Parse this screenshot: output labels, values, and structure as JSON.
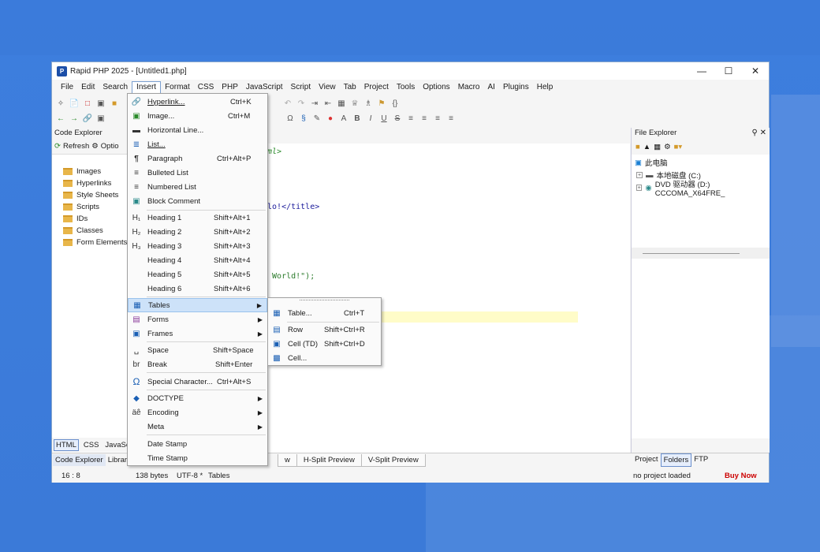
{
  "window": {
    "title": "Rapid PHP 2025 - [Untitled1.php]"
  },
  "menubar": [
    "File",
    "Edit",
    "Search",
    "Insert",
    "Format",
    "CSS",
    "PHP",
    "JavaScript",
    "Script",
    "View",
    "Tab",
    "Project",
    "Tools",
    "Options",
    "Macro",
    "AI",
    "Plugins",
    "Help"
  ],
  "code_explorer": {
    "title": "Code Explorer",
    "refresh": "Refresh",
    "options": "Optio",
    "items": [
      "Images",
      "Hyperlinks",
      "Style Sheets",
      "Scripts",
      "IDs",
      "Classes",
      "Form Elements"
    ],
    "bottom_tabs": [
      "HTML",
      "CSS",
      "JavaScri"
    ]
  },
  "editor": {
    "lines": [
      "tml>",
      "",
      "",
      "",
      "llo!</title>",
      "",
      "",
      "",
      "",
      ", World!\");",
      "",
      "",
      ""
    ]
  },
  "file_explorer": {
    "title": "File Explorer",
    "root": "此电脑",
    "drives": [
      "本地磁盘 (C:)",
      "DVD 驱动器 (D:) CCCOMA_X64FRE_"
    ]
  },
  "insert_menu": [
    {
      "label": "Hyperlink...",
      "shortcut": "Ctrl+K",
      "icon": "link-icon"
    },
    {
      "label": "Image...",
      "shortcut": "Ctrl+M",
      "icon": "image-icon"
    },
    {
      "label": "Horizontal Line...",
      "shortcut": "",
      "icon": "horizontal-line-icon"
    },
    {
      "label": "List...",
      "shortcut": "",
      "icon": "list-icon"
    },
    {
      "label": "Paragraph",
      "shortcut": "Ctrl+Alt+P",
      "icon": "paragraph-icon"
    },
    {
      "label": "Bulleted List",
      "shortcut": "",
      "icon": "bulleted-list-icon"
    },
    {
      "label": "Numbered List",
      "shortcut": "",
      "icon": "numbered-list-icon"
    },
    {
      "label": "Block Comment",
      "shortcut": "",
      "icon": "comment-icon"
    },
    {
      "label": "Heading 1",
      "shortcut": "Shift+Alt+1",
      "icon": "h1-icon"
    },
    {
      "label": "Heading 2",
      "shortcut": "Shift+Alt+2",
      "icon": "h2-icon"
    },
    {
      "label": "Heading 3",
      "shortcut": "Shift+Alt+3",
      "icon": "h3-icon"
    },
    {
      "label": "Heading 4",
      "shortcut": "Shift+Alt+4",
      "icon": ""
    },
    {
      "label": "Heading 5",
      "shortcut": "Shift+Alt+5",
      "icon": ""
    },
    {
      "label": "Heading 6",
      "shortcut": "Shift+Alt+6",
      "icon": ""
    },
    {
      "label": "Tables",
      "shortcut": "",
      "icon": "table-icon",
      "submenu": true
    },
    {
      "label": "Forms",
      "shortcut": "",
      "icon": "form-icon",
      "submenu": true
    },
    {
      "label": "Frames",
      "shortcut": "",
      "icon": "frame-icon",
      "submenu": true
    },
    {
      "label": "Space",
      "shortcut": "Shift+Space",
      "icon": "space-icon"
    },
    {
      "label": "Break",
      "shortcut": "Shift+Enter",
      "icon": "break-icon"
    },
    {
      "label": "Special Character...",
      "shortcut": "Ctrl+Alt+S",
      "icon": "omega-icon"
    },
    {
      "label": "DOCTYPE",
      "shortcut": "",
      "icon": "tag-icon",
      "submenu": true
    },
    {
      "label": "Encoding",
      "shortcut": "",
      "icon": "encoding-icon",
      "submenu": true
    },
    {
      "label": "Meta",
      "shortcut": "",
      "icon": "",
      "submenu": true
    },
    {
      "label": "Date Stamp",
      "shortcut": "",
      "icon": ""
    },
    {
      "label": "Time Stamp",
      "shortcut": "",
      "icon": ""
    }
  ],
  "tables_submenu": [
    {
      "label": "Table...",
      "shortcut": "Ctrl+T"
    },
    {
      "label": "Row",
      "shortcut": "Shift+Ctrl+R"
    },
    {
      "label": "Cell (TD)",
      "shortcut": "Shift+Ctrl+D"
    },
    {
      "label": "Cell...",
      "shortcut": ""
    }
  ],
  "bottom_tabs": {
    "left": [
      "Code Explorer",
      "Library"
    ],
    "middle": [
      "w",
      "H-Split Preview",
      "V-Split Preview"
    ],
    "right": [
      "Project",
      "Folders",
      "FTP"
    ]
  },
  "status": {
    "position": "16 : 8",
    "size": "138 bytes",
    "encoding": "UTF-8 *",
    "context": "Tables",
    "project": "no project loaded",
    "buy": "Buy Now"
  }
}
